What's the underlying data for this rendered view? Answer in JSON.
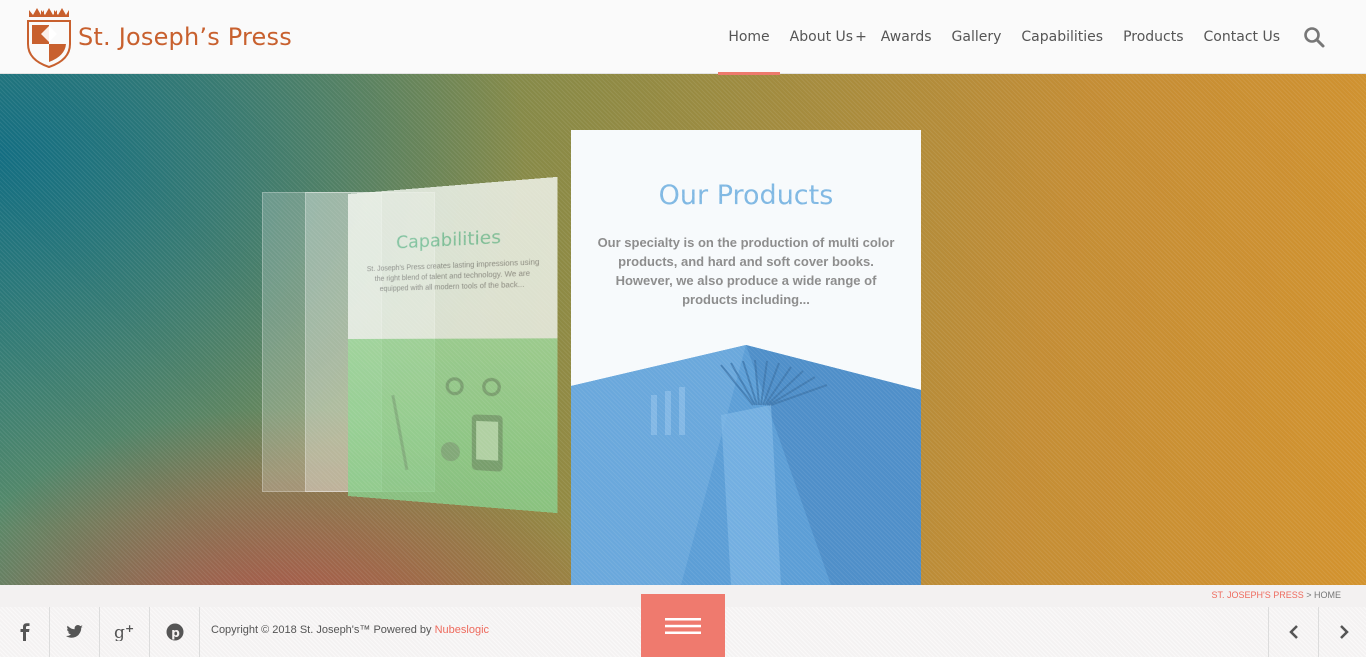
{
  "brand": {
    "name": "St. Joseph’s Press",
    "color": "#c8602e"
  },
  "nav": {
    "items": [
      {
        "label": "Home",
        "active": true
      },
      {
        "label": "About Us",
        "suffix": "+"
      },
      {
        "label": "Awards"
      },
      {
        "label": "Gallery"
      },
      {
        "label": "Capabilities"
      },
      {
        "label": "Products"
      },
      {
        "label": "Contact Us"
      }
    ],
    "search_icon": "search-icon",
    "active_color": "#ee7a6d"
  },
  "hero": {
    "capabilities_panel": {
      "title": "Capabilities",
      "text": "St. Joseph's Press creates lasting impressions using the right blend of talent and technology. We are equipped with all modern tools of the back..."
    },
    "products_card": {
      "title": "Our Products",
      "text": "Our specialty is on the production of multi color products, and hard and soft cover books. However, we also produce a wide range of products including...",
      "title_color": "#7fb8e3"
    }
  },
  "breadcrumb": {
    "link": "ST. JOSEPH'S PRESS",
    "separator": " > ",
    "current": "HOME"
  },
  "footer": {
    "social": [
      "facebook-icon",
      "twitter-icon",
      "google-plus-icon",
      "pinterest-icon"
    ],
    "copyright": "Copyright © 2018 St. Joseph's™ Powered by ",
    "powered_by": "Nubeslogic",
    "menu_icon": "hamburger-menu-icon",
    "accent": "#ef7a6e"
  }
}
